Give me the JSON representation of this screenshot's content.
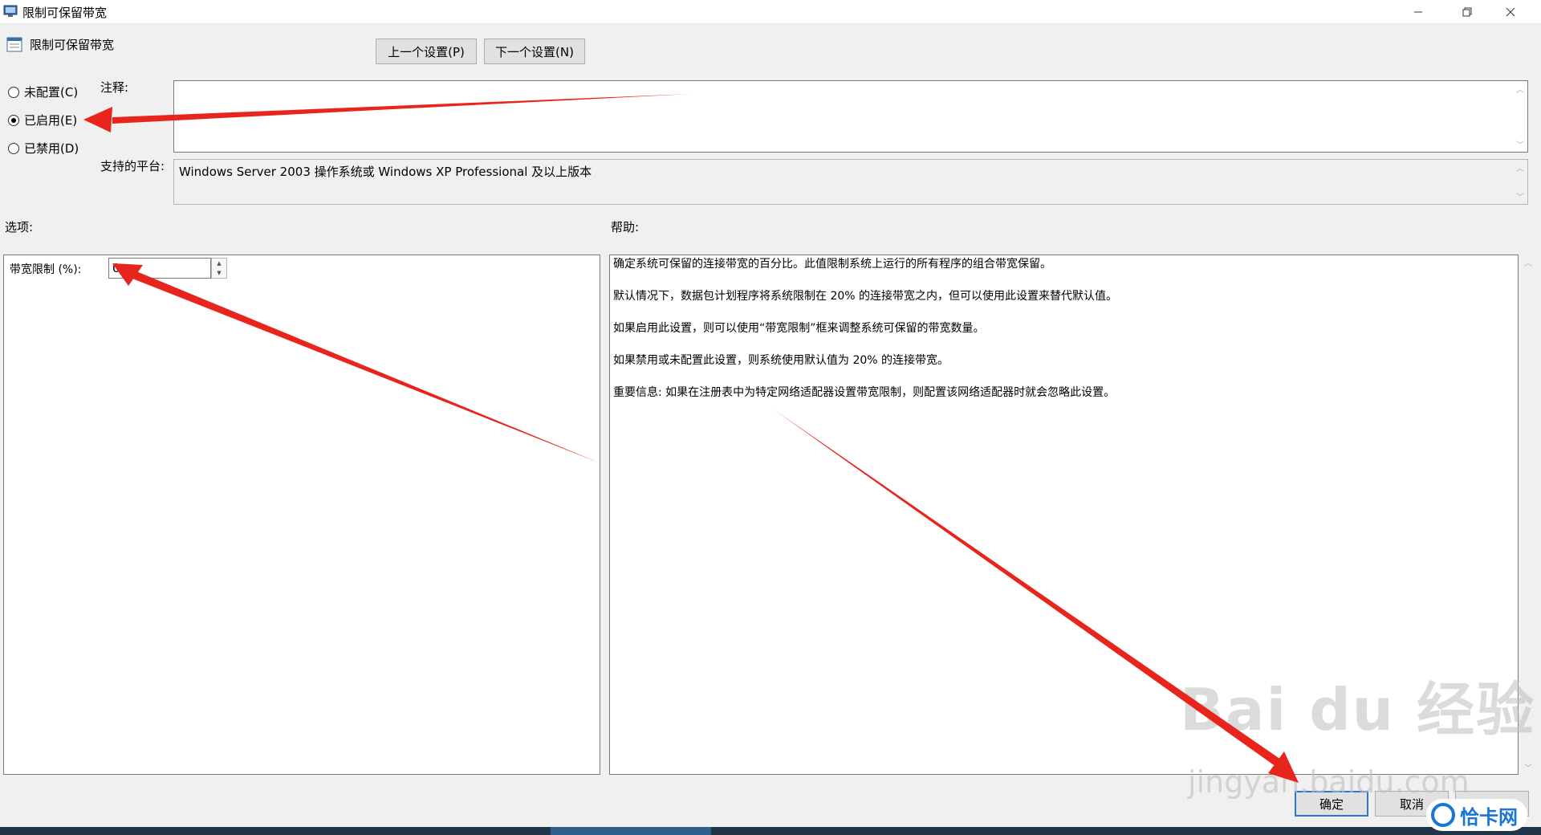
{
  "window": {
    "title": "限制可保留带宽",
    "minimize_icon": "minimize-icon",
    "restore_icon": "restore-icon",
    "close_icon": "close-icon"
  },
  "header": {
    "heading": "限制可保留带宽",
    "prev_button": "上一个设置(P)",
    "next_button": "下一个设置(N)"
  },
  "state": {
    "options": [
      {
        "label": "未配置(C)",
        "checked": false
      },
      {
        "label": "已启用(E)",
        "checked": true
      },
      {
        "label": "已禁用(D)",
        "checked": false
      }
    ]
  },
  "comment": {
    "label": "注释:",
    "value": ""
  },
  "platform": {
    "label": "支持的平台:",
    "value": "Windows Server 2003 操作系统或 Windows XP Professional 及以上版本"
  },
  "options_section": {
    "label": "选项:",
    "bandwidth_label": "带宽限制 (%):",
    "bandwidth_value": "0"
  },
  "help_section": {
    "label": "帮助:",
    "paragraphs": [
      "确定系统可保留的连接带宽的百分比。此值限制系统上运行的所有程序的组合带宽保留。",
      "默认情况下，数据包计划程序将系统限制在 20% 的连接带宽之内，但可以使用此设置来替代默认值。",
      "如果启用此设置，则可以使用“带宽限制”框来调整系统可保留的带宽数量。",
      "如果禁用或未配置此设置，则系统使用默认值为 20% 的连接带宽。",
      "重要信息: 如果在注册表中为特定网络适配器设置带宽限制，则配置该网络适配器时就会忽略此设置。"
    ]
  },
  "footer": {
    "ok_button": "确定",
    "cancel_button": "取消",
    "apply_button": ""
  },
  "overlay": {
    "watermark_main": "Bai du 经验",
    "watermark_sub": "jingyan.baidu.com",
    "site_badge": "恰卡网",
    "arrow_color": "#e8251c"
  },
  "colors": {
    "accent": "#2a78d6"
  }
}
